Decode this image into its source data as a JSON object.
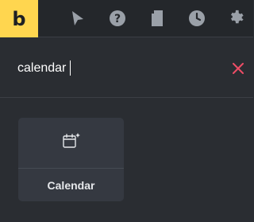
{
  "brand": {
    "logo_text": "b",
    "accent": "#ffd64f"
  },
  "toolbar": {
    "icons": [
      "pointer-icon",
      "help-icon",
      "document-icon",
      "history-icon",
      "settings-icon"
    ],
    "icon_color": "#9aa0a8"
  },
  "search": {
    "value": "calendar",
    "clear_icon": "close-icon",
    "clear_color": "#ee4d66"
  },
  "results": [
    {
      "label": "Calendar",
      "icon": "calendar-icon"
    }
  ]
}
